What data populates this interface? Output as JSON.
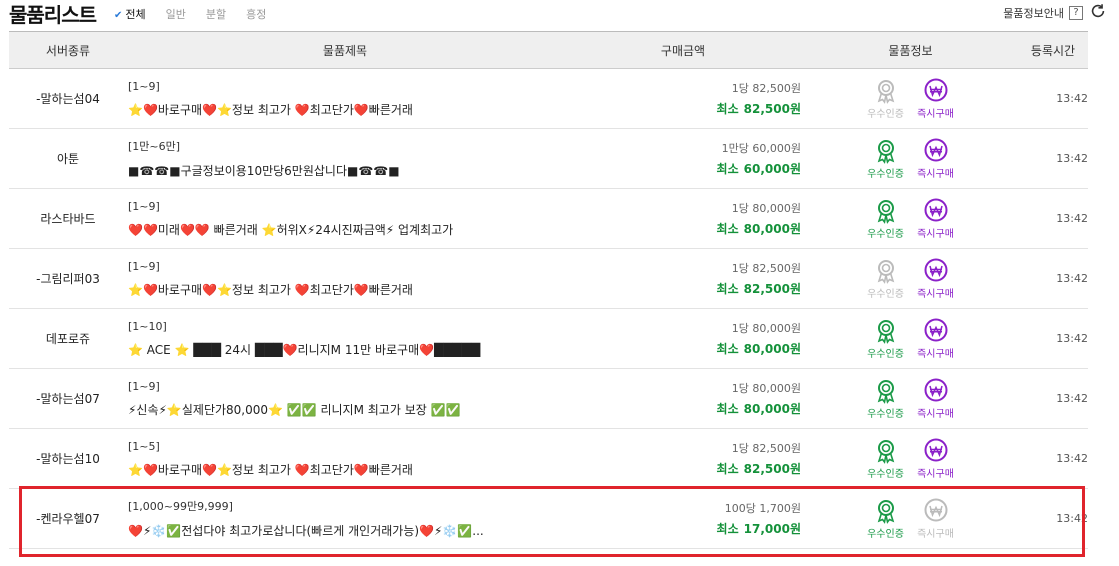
{
  "header": {
    "title": "물품리스트",
    "filters": [
      {
        "label": "전체",
        "active": true
      },
      {
        "label": "일반",
        "active": false
      },
      {
        "label": "분할",
        "active": false
      },
      {
        "label": "흥정",
        "active": false
      }
    ],
    "info_label": "물품정보안내",
    "help_glyph": "?",
    "refresh_icon": "refresh-icon"
  },
  "table": {
    "columns": [
      "서버종류",
      "물품제목",
      "구매금액",
      "물품정보",
      "등록시간"
    ],
    "cert_label": "우수인증",
    "buy_label": "즉시구매",
    "min_label": "최소",
    "colors": {
      "cert": "#1b9a48",
      "buy": "#8b21c9",
      "price": "#14913a",
      "disabled": "#bbbbbb",
      "highlight": "#e0242c"
    },
    "rows": [
      {
        "server": "-말하는섬04",
        "qty": "[1~9]",
        "title": "⭐❤️바로구매❤️⭐정보 최고가 ❤️최고단가❤️빠른거래",
        "unit": "1당 82,500원",
        "min": "82,500원",
        "cert": false,
        "buy": true,
        "time": "13:42"
      },
      {
        "server": "아툰",
        "qty": "[1만~6만]",
        "title": "■☎☎■구글정보이용10만당6만원삽니다■☎☎■",
        "unit": "1만당 60,000원",
        "min": "60,000원",
        "cert": true,
        "buy": true,
        "time": "13:42"
      },
      {
        "server": "라스타바드",
        "qty": "[1~9]",
        "title": "❤️❤️미래❤️❤️ 빠른거래 ⭐허위X⚡24시진짜금액⚡ 업계최고가",
        "unit": "1당 80,000원",
        "min": "80,000원",
        "cert": true,
        "buy": true,
        "time": "13:42"
      },
      {
        "server": "-그림리퍼03",
        "qty": "[1~9]",
        "title": "⭐❤️바로구매❤️⭐정보 최고가 ❤️최고단가❤️빠른거래",
        "unit": "1당 82,500원",
        "min": "82,500원",
        "cert": false,
        "buy": true,
        "time": "13:42"
      },
      {
        "server": "데포로쥬",
        "qty": "[1~10]",
        "title": "⭐ ACE ⭐ ███ 24시 ███❤️리니지M 11만 바로구매❤️█████",
        "unit": "1당 80,000원",
        "min": "80,000원",
        "cert": true,
        "buy": true,
        "time": "13:42"
      },
      {
        "server": "-말하는섬07",
        "qty": "[1~9]",
        "title": "⚡신속⚡⭐실제단가80,000⭐ ✅✅ 리니지M 최고가 보장 ✅✅",
        "unit": "1당 80,000원",
        "min": "80,000원",
        "cert": true,
        "buy": true,
        "time": "13:42"
      },
      {
        "server": "-말하는섬10",
        "qty": "[1~5]",
        "title": "⭐❤️바로구매❤️⭐정보 최고가 ❤️최고단가❤️빠른거래",
        "unit": "1당 82,500원",
        "min": "82,500원",
        "cert": true,
        "buy": true,
        "time": "13:42"
      },
      {
        "server": "-켄라우헬07",
        "qty": "[1,000~99만9,999]",
        "title": "❤️⚡❄️✅전섭다야 최고가로삽니다(빠르게 개인거래가능)❤️⚡❄️✅...",
        "unit": "100당 1,700원",
        "min": "17,000원",
        "cert": true,
        "buy": false,
        "time": "13:42"
      }
    ]
  }
}
